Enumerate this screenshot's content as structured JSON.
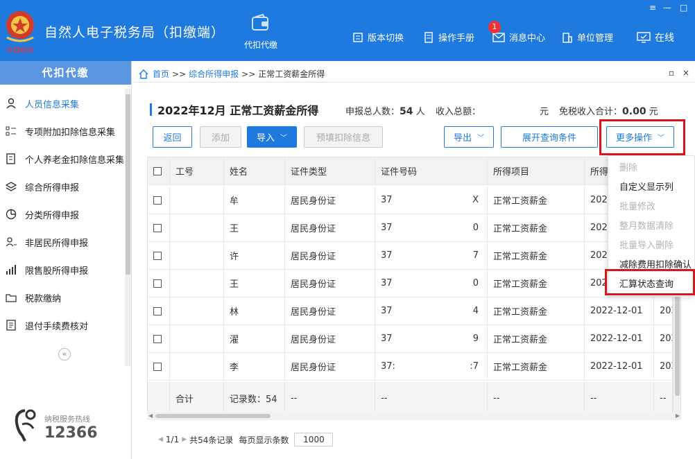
{
  "header": {
    "logo_text": "中国税务",
    "app_title": "自然人电子税务局（扣缴端）",
    "main_module": "代扣代缴",
    "nav": [
      {
        "label": "版本切换",
        "icon": "switch-icon"
      },
      {
        "label": "操作手册",
        "icon": "manual-icon"
      },
      {
        "label": "消息中心",
        "icon": "mail-icon",
        "badge": "1"
      },
      {
        "label": "单位管理",
        "icon": "building-icon"
      },
      {
        "label": "在线",
        "icon": "monitor-icon"
      }
    ],
    "window_controls": {
      "menu": "≡",
      "minimize": "—",
      "maximize": "□"
    }
  },
  "sidebar": {
    "title": "代扣代缴",
    "items": [
      {
        "label": "人员信息采集",
        "icon": "person-icon",
        "active": true
      },
      {
        "label": "专项附加扣除信息采集",
        "icon": "list-icon",
        "active": false
      },
      {
        "label": "个人养老金扣除信息采集",
        "icon": "document-icon",
        "active": false
      },
      {
        "label": "综合所得申报",
        "icon": "layers-icon",
        "active": false
      },
      {
        "label": "分类所得申报",
        "icon": "pie-icon",
        "active": false
      },
      {
        "label": "非居民所得申报",
        "icon": "person-list-icon",
        "active": false
      },
      {
        "label": "限售股所得申报",
        "icon": "bar-chart-icon",
        "active": false
      },
      {
        "label": "税款缴纳",
        "icon": "folder-icon",
        "active": false
      },
      {
        "label": "退付手续费核对",
        "icon": "checklist-icon",
        "active": false
      }
    ],
    "collapse": "«",
    "hotline_caption": "纳税服务热线",
    "hotline_number": "12366"
  },
  "breadcrumb": {
    "home": "首页",
    "sep": ">>",
    "level1": "综合所得申报",
    "level2": "正常工资薪金所得",
    "ctl_restore": "▫",
    "ctl_close": "×"
  },
  "page": {
    "title": "2022年12月 正常工资薪金所得",
    "total_people_label": "申报总人数：",
    "total_people_value": "54",
    "total_people_unit": "人",
    "income_label": "收入总额：",
    "income_unit": "元",
    "exempt_label": "免税收入合计：",
    "exempt_value": "0.00",
    "exempt_unit": "元"
  },
  "toolbar": {
    "back": "返回",
    "add": "添加",
    "import": "导入",
    "prefill": "预填扣除信息",
    "export": "导出",
    "expand_query": "展开查询条件",
    "more_ops": "更多操作"
  },
  "table": {
    "headers": [
      "工号",
      "姓名",
      "证件类型",
      "证件号码",
      "所得项目",
      "所得"
    ],
    "rows": [
      {
        "id": "",
        "name": "牟",
        "cert_type": "居民身份证",
        "cert_prefix": "37",
        "cert_suffix": "X",
        "item": "正常工资薪金",
        "date": "202",
        "extra": ""
      },
      {
        "id": "",
        "name": "王",
        "cert_type": "居民身份证",
        "cert_prefix": "37",
        "cert_suffix": "0",
        "item": "正常工资薪金",
        "date": "202",
        "extra": ""
      },
      {
        "id": "",
        "name": "许",
        "cert_type": "居民身份证",
        "cert_prefix": "37",
        "cert_suffix": "7",
        "item": "正常工资薪金",
        "date": "202",
        "extra": ""
      },
      {
        "id": "",
        "name": "王",
        "cert_type": "居民身份证",
        "cert_prefix": "37",
        "cert_suffix": "0",
        "item": "正常工资薪金",
        "date": "202",
        "extra": ""
      },
      {
        "id": "",
        "name": "林",
        "cert_type": "居民身份证",
        "cert_prefix": "37",
        "cert_suffix": "4",
        "item": "正常工资薪金",
        "date": "2022-12-01",
        "extra": "202"
      },
      {
        "id": "",
        "name": "濯",
        "cert_type": "居民身份证",
        "cert_prefix": "37",
        "cert_suffix": "9",
        "item": "正常工资薪金",
        "date": "2022-12-01",
        "extra": "202"
      },
      {
        "id": "",
        "name": "李",
        "cert_type": "居民身份证",
        "cert_prefix": "37:",
        "cert_suffix": ":7",
        "item": "正常工资薪金",
        "date": "2022-12-01",
        "extra": "202"
      }
    ],
    "footer": {
      "label": "合计",
      "records": "记录数：54",
      "dash": "--"
    }
  },
  "dropdown": {
    "items": [
      {
        "label": "删除",
        "enabled": false
      },
      {
        "label": "自定义显示列",
        "enabled": true
      },
      {
        "label": "批量修改",
        "enabled": false
      },
      {
        "label": "整月数据清除",
        "enabled": false
      },
      {
        "label": "批量导入删除",
        "enabled": false
      },
      {
        "label": "减除费用扣除确认",
        "enabled": true
      },
      {
        "label": "汇算状态查询",
        "enabled": true
      }
    ]
  },
  "pager": {
    "page": "1/1",
    "total": "共54条记录",
    "per_page_label": "每页显示条数",
    "per_page_value": "1000"
  },
  "colors": {
    "brand": "#1f7ae0",
    "highlight": "#d9151c",
    "sidebar_title": "#5b97e1"
  }
}
